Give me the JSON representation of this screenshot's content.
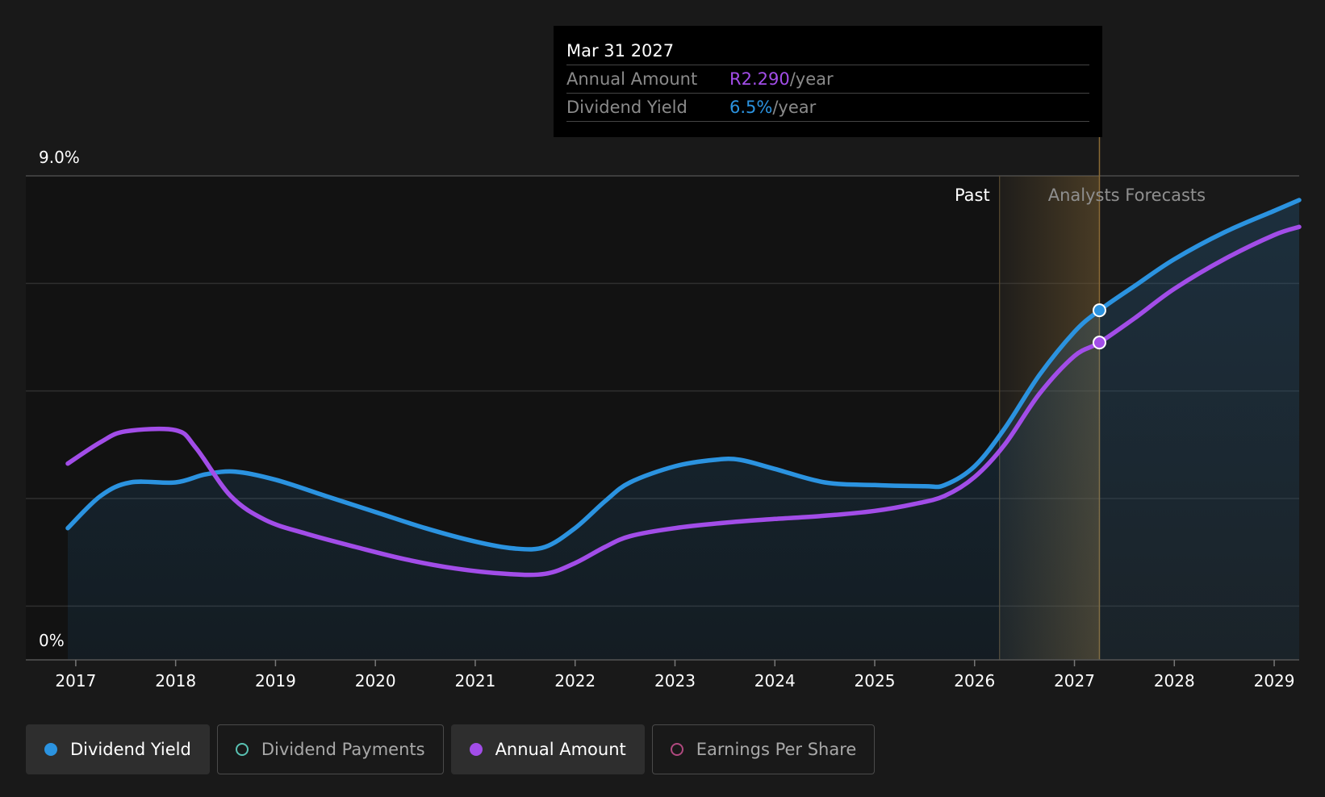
{
  "colors": {
    "dividend_yield": "#2b93e0",
    "annual_amount": "#a24de8",
    "dividend_payments": "#59c2b3",
    "earnings_per_share": "#b0497f",
    "forecast_band": "#8a6a35"
  },
  "tooltip": {
    "date": "Mar 31 2027",
    "rows": [
      {
        "label": "Annual Amount",
        "value": "R2.290",
        "unit": "/year",
        "color": "#a24de8"
      },
      {
        "label": "Dividend Yield",
        "value": "6.5%",
        "unit": "/year",
        "color": "#2b93e0"
      }
    ]
  },
  "legend": [
    {
      "label": "Dividend Yield",
      "active": true,
      "filled": true,
      "color": "#2b93e0"
    },
    {
      "label": "Dividend Payments",
      "active": false,
      "filled": false,
      "color": "#59c2b3"
    },
    {
      "label": "Annual Amount",
      "active": true,
      "filled": true,
      "color": "#a24de8"
    },
    {
      "label": "Earnings Per Share",
      "active": false,
      "filled": false,
      "color": "#b0497f"
    }
  ],
  "chart_data": {
    "type": "line",
    "title": "",
    "xlabel": "",
    "ylabel": "",
    "ylim": [
      0,
      9
    ],
    "y_tick_labels": [
      "9.0%",
      "0%"
    ],
    "x_range": [
      2016.5,
      2029.25
    ],
    "x_ticks": [
      "2017",
      "2018",
      "2019",
      "2020",
      "2021",
      "2022",
      "2023",
      "2024",
      "2025",
      "2026",
      "2027",
      "2028",
      "2029"
    ],
    "grid": true,
    "past_label": "Past",
    "forecast_label": "Analysts Forecasts",
    "forecast_start": 2026.25,
    "hover_x": 2027.25,
    "series": [
      {
        "name": "Dividend Yield",
        "color": "#2b93e0",
        "area": true,
        "x": [
          2016.92,
          2017.25,
          2017.55,
          2018.0,
          2018.3,
          2018.6,
          2019.0,
          2019.5,
          2020.0,
          2020.5,
          2021.0,
          2021.4,
          2021.7,
          2022.0,
          2022.3,
          2022.55,
          2023.0,
          2023.4,
          2023.65,
          2024.0,
          2024.5,
          2025.0,
          2025.5,
          2025.7,
          2026.0,
          2026.3,
          2026.65,
          2027.0,
          2027.25,
          2027.6,
          2028.0,
          2028.5,
          2029.0,
          2029.25
        ],
        "values": [
          2.45,
          3.05,
          3.3,
          3.3,
          3.45,
          3.5,
          3.35,
          3.05,
          2.75,
          2.45,
          2.2,
          2.07,
          2.1,
          2.45,
          2.95,
          3.3,
          3.6,
          3.72,
          3.72,
          3.55,
          3.3,
          3.25,
          3.23,
          3.25,
          3.6,
          4.3,
          5.3,
          6.1,
          6.5,
          6.95,
          7.45,
          7.95,
          8.35,
          8.55
        ]
      },
      {
        "name": "Annual Amount",
        "color": "#a24de8",
        "area": false,
        "x": [
          2016.92,
          2017.25,
          2017.5,
          2018.0,
          2018.2,
          2018.55,
          2018.9,
          2019.3,
          2019.8,
          2020.3,
          2020.8,
          2021.3,
          2021.7,
          2022.0,
          2022.3,
          2022.55,
          2023.0,
          2023.5,
          2024.0,
          2024.5,
          2025.0,
          2025.4,
          2025.7,
          2026.0,
          2026.3,
          2026.65,
          2027.0,
          2027.25,
          2027.6,
          2028.0,
          2028.5,
          2029.0,
          2029.25
        ],
        "values": [
          3.65,
          4.05,
          4.25,
          4.27,
          3.95,
          3.05,
          2.6,
          2.35,
          2.1,
          1.87,
          1.7,
          1.6,
          1.6,
          1.8,
          2.1,
          2.3,
          2.45,
          2.55,
          2.62,
          2.68,
          2.77,
          2.9,
          3.05,
          3.4,
          4.0,
          4.95,
          5.65,
          5.9,
          6.35,
          6.9,
          7.45,
          7.9,
          8.05
        ]
      }
    ]
  }
}
